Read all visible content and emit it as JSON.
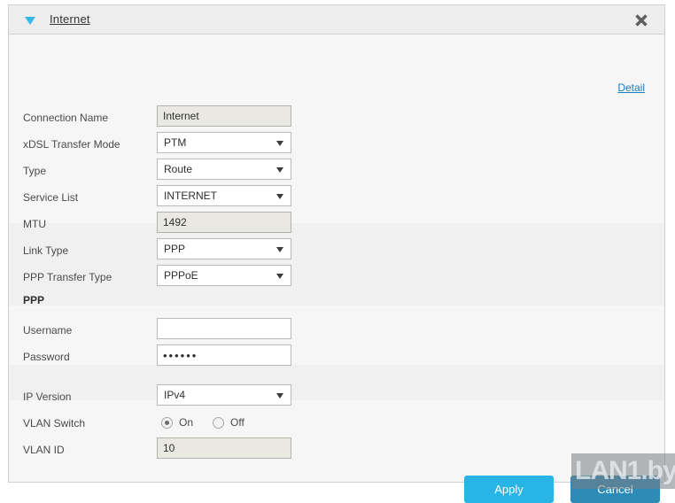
{
  "window": {
    "title": "Internet",
    "toggle_icon": "triangle-down-icon",
    "close_icon": "close-icon"
  },
  "detail": {
    "label": "Detail"
  },
  "form": {
    "rows": [
      {
        "label": "Connection Name",
        "value": "Internet",
        "control": "readonly-input"
      },
      {
        "label": "xDSL Transfer Mode",
        "value": "PTM",
        "control": "select"
      },
      {
        "label": "Type",
        "value": "Route",
        "control": "select"
      },
      {
        "label": "Service List",
        "value": "INTERNET",
        "control": "select"
      },
      {
        "label": "MTU",
        "value": "1492",
        "control": "readonly-input"
      },
      {
        "label": "Link Type",
        "value": "PPP",
        "control": "select"
      },
      {
        "label": "PPP Transfer Type",
        "value": "PPPoE",
        "control": "select"
      }
    ]
  },
  "ppp_section": {
    "heading": "PPP",
    "username": {
      "label": "Username",
      "value": "",
      "placeholder": ""
    },
    "password": {
      "label": "Password",
      "value": "••••••"
    }
  },
  "network_section": {
    "ip_version": {
      "label": "IP Version",
      "value": "IPv4"
    },
    "vlan_switch": {
      "label": "VLAN Switch",
      "selected": "On",
      "options": [
        {
          "label": "On",
          "checked": true
        },
        {
          "label": "Off",
          "checked": false
        }
      ]
    },
    "vlan_id": {
      "label": "VLAN ID",
      "value": "10"
    }
  },
  "footer": {
    "apply_label": "Apply",
    "cancel_label": "Cancel"
  },
  "watermark": {
    "text": "LAN1.by"
  },
  "colors": {
    "accent": "#29b4e6",
    "cancel": "#2d8bb8",
    "link": "#1a7fc1",
    "toggle_triangle": "#35b9e8",
    "panel_bg": "#f6f6f6",
    "band_bg": "#f0f0f0",
    "readonly_bg": "#e9e9e1"
  }
}
